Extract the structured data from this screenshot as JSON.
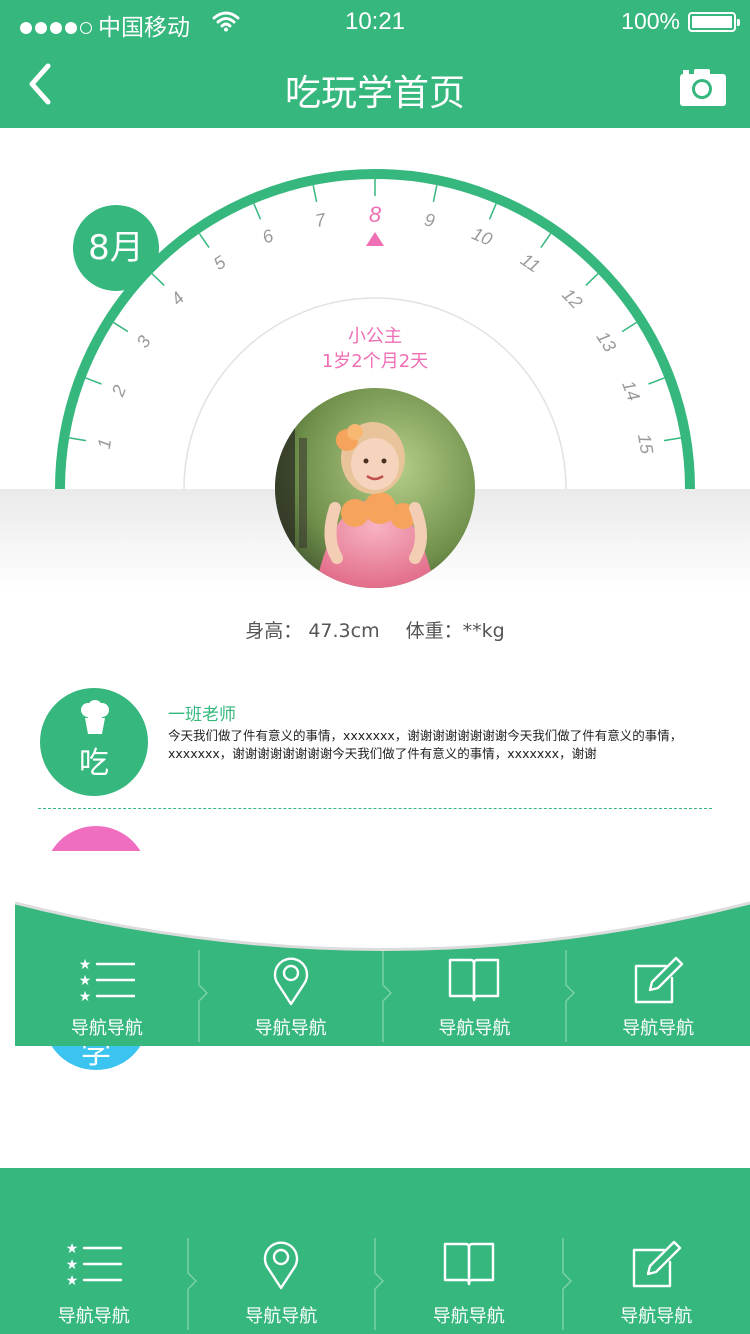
{
  "status_bar": {
    "carrier": "中国移动",
    "time": "10:21",
    "battery_pct": "100%",
    "signal_bars_filled": 4,
    "signal_bars_total": 5
  },
  "nav": {
    "title": "吃玩学首页",
    "back_icon": "chevron-left-icon",
    "camera_icon": "camera-icon"
  },
  "dial": {
    "month_badge": "8月",
    "ticks": [
      "1",
      "2",
      "3",
      "4",
      "5",
      "6",
      "7",
      "8",
      "9",
      "10",
      "11",
      "12",
      "13",
      "14",
      "15"
    ],
    "selected": "8",
    "baby_name": "小公主",
    "baby_age": "1岁2个月2天"
  },
  "metrics": {
    "height": "身高： 47.3cm",
    "weight": "体重：**kg"
  },
  "feed": [
    {
      "category": "吃",
      "author": "一班老师",
      "text": "今天我们做了件有意义的事情，xxxxxxx，谢谢谢谢谢谢谢谢今天我们做了件有意义的事情，xxxxxxx，谢谢谢谢谢谢谢谢今天我们做了件有意义的事情，xxxxxxx，谢谢"
    }
  ],
  "floating_nav": [
    {
      "label": "导航导航",
      "icon": "star-list-icon"
    },
    {
      "label": "导航导航",
      "icon": "location-pin-icon"
    },
    {
      "label": "导航导航",
      "icon": "book-icon"
    },
    {
      "label": "导航导航",
      "icon": "edit-icon"
    }
  ],
  "bottom_nav": [
    {
      "label": "导航导航",
      "icon": "star-list-icon"
    },
    {
      "label": "导航导航",
      "icon": "location-pin-icon"
    },
    {
      "label": "导航导航",
      "icon": "book-icon"
    },
    {
      "label": "导航导航",
      "icon": "edit-icon"
    }
  ],
  "colors": {
    "brand_green": "#35b77d",
    "accent_pink": "#ee6fb4",
    "accent_blue": "#3cc4f0",
    "tick_gray": "#9a9a9a"
  }
}
